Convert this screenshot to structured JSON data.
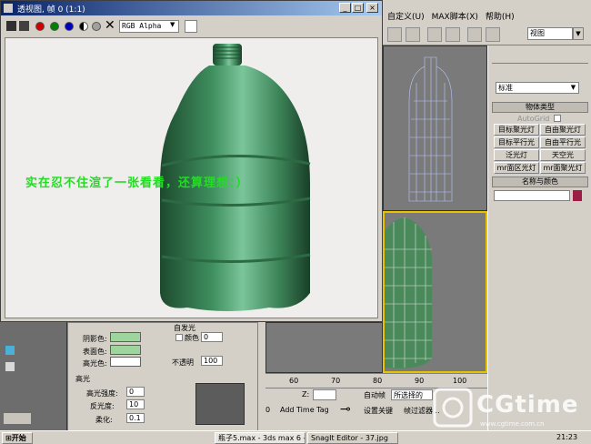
{
  "render_window": {
    "title": "透视图, 帧 0 (1:1)",
    "channel": "RGB Alpha",
    "caption": "实在忍不住渲了一张看看，还算理想：）"
  },
  "menus": [
    "自定义(U)",
    "MAX脚本(X)",
    "帮助(H)"
  ],
  "view_select": "视图",
  "command_panel": {
    "category": "标准",
    "object_type_title": "物体类型",
    "autogrid": "AutoGrid",
    "buttons": [
      "目标聚光灯",
      "自由聚光灯",
      "目标平行光",
      "自由平行光",
      "泛光灯",
      "天空光",
      "mr面区光灯",
      "mr面聚光灯"
    ],
    "name_color_title": "名称与颜色",
    "name_color_hex": "#9c1e44"
  },
  "material": {
    "ambient_label": "阴影色:",
    "diffuse_label": "表面色:",
    "specular_label": "高光色:",
    "self_illum_title": "自发光",
    "color_label": "颜色",
    "self_illum_value": "0",
    "opacity_label": "不透明",
    "opacity_value": "100",
    "highlight_title": "高光",
    "spec_level_label": "高光强度:",
    "spec_level_value": "0",
    "gloss_label": "反光度:",
    "gloss_value": "10",
    "soften_label": "柔化:",
    "soften_value": "0.1",
    "swatch_color": "#9ed59e"
  },
  "timeline": {
    "ticks": [
      "60",
      "70",
      "80",
      "90",
      "100"
    ],
    "z_label": "Z:",
    "add_time_tag": "Add Time Tag",
    "auto_key": "自动帧",
    "set_key": "设置关键",
    "selected": "所选择的",
    "key_filters": "帧过滤器...",
    "frame": "0"
  },
  "taskbar": {
    "start": "开始",
    "tasks": [
      "瓶子5.max - 3ds max 6 - ...",
      "SnagIt Editor - 37.jpg"
    ],
    "clock": "21:23"
  },
  "watermark": {
    "brand": "CGtime",
    "url": "www.cgtime.com.cn"
  },
  "colors": {
    "title_start": "#0a246a",
    "title_end": "#a6caf0",
    "bottle": "#3f8f5f",
    "caption": "#22dd22",
    "viewport_bg": "#7a7a7a",
    "active_border": "#e8c400"
  }
}
